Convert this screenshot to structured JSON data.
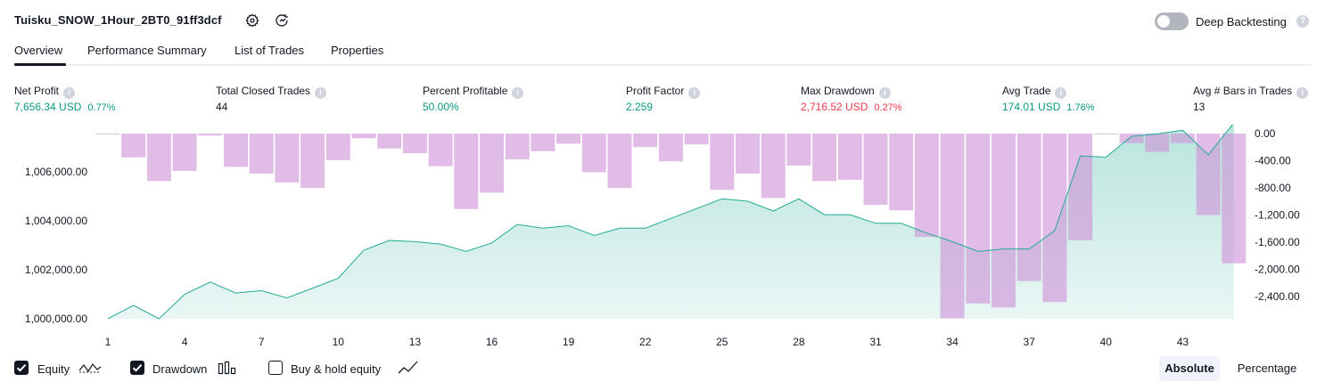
{
  "header": {
    "strategy_name": "Tuisku_SNOW_1Hour_2BT0_91ff3dcf",
    "icons": [
      "settings-icon",
      "compare-icon"
    ],
    "deep_backtesting_label": "Deep Backtesting",
    "deep_backtesting_enabled": false
  },
  "tabs": [
    {
      "label": "Overview",
      "active": true
    },
    {
      "label": "Performance Summary",
      "active": false
    },
    {
      "label": "List of Trades",
      "active": false
    },
    {
      "label": "Properties",
      "active": false
    }
  ],
  "metrics": [
    {
      "label": "Net Profit",
      "value": "7,656.34 USD",
      "pct": "0.77%",
      "color": "#089981"
    },
    {
      "label": "Total Closed Trades",
      "value": "44",
      "pct": "",
      "color": "#131722"
    },
    {
      "label": "Percent Profitable",
      "value": "50.00%",
      "pct": "",
      "color": "#089981"
    },
    {
      "label": "Profit Factor",
      "value": "2.259",
      "pct": "",
      "color": "#089981"
    },
    {
      "label": "Max Drawdown",
      "value": "2,716.52 USD",
      "pct": "0.27%",
      "color": "#f23645"
    },
    {
      "label": "Avg Trade",
      "value": "174.01 USD",
      "pct": "1.76%",
      "color": "#089981"
    },
    {
      "label": "Avg # Bars in Trades",
      "value": "13",
      "pct": "",
      "color": "#131722"
    }
  ],
  "chart_data": {
    "type": "area",
    "x_ticks": [
      "1",
      "4",
      "7",
      "10",
      "13",
      "16",
      "19",
      "22",
      "25",
      "28",
      "31",
      "34",
      "37",
      "40",
      "43"
    ],
    "y_left_ticks": [
      "1,000,000.00",
      "1,002,000.00",
      "1,004,000.00",
      "1,006,000.00"
    ],
    "y_right_ticks": [
      "0.00",
      "-400.00",
      "-800.00",
      "-1,200.00",
      "-1,600.00",
      "-2,000.00",
      "-2,400.00"
    ],
    "series": [
      {
        "name": "Equity",
        "x": [
          1,
          2,
          3,
          4,
          5,
          6,
          7,
          8,
          9,
          10,
          11,
          12,
          13,
          14,
          15,
          16,
          17,
          18,
          19,
          20,
          21,
          22,
          23,
          24,
          25,
          26,
          27,
          28,
          29,
          30,
          31,
          32,
          33,
          34,
          35,
          36,
          37,
          38,
          39,
          40,
          41,
          42,
          43,
          44,
          45
        ],
        "values": [
          1000000,
          1000550,
          1000000,
          1001000,
          1001500,
          1001050,
          1001150,
          1000850,
          1001250,
          1001650,
          1002800,
          1003200,
          1003150,
          1003050,
          1002750,
          1003100,
          1003850,
          1003700,
          1003800,
          1003400,
          1003700,
          1003700,
          1004100,
          1004500,
          1004900,
          1004800,
          1004400,
          1004900,
          1004250,
          1004250,
          1003900,
          1003900,
          1003500,
          1003150,
          1002750,
          1002850,
          1002850,
          1003600,
          1006650,
          1006600,
          1007450,
          1007550,
          1007700,
          1006700,
          1008000
        ],
        "color": "#22ab94"
      },
      {
        "name": "Drawdown",
        "x": [
          1,
          2,
          3,
          4,
          5,
          6,
          7,
          8,
          9,
          10,
          11,
          12,
          13,
          14,
          15,
          16,
          17,
          18,
          19,
          20,
          21,
          22,
          23,
          24,
          25,
          26,
          27,
          28,
          29,
          30,
          31,
          32,
          33,
          34,
          35,
          36,
          37,
          38,
          39,
          40,
          41,
          42,
          43,
          44,
          45
        ],
        "values": [
          -10,
          -350,
          -700,
          -550,
          -30,
          -490,
          -590,
          -720,
          -800,
          -390,
          -70,
          -220,
          -290,
          -480,
          -1110,
          -870,
          -380,
          -260,
          -150,
          -570,
          -800,
          -200,
          -410,
          -160,
          -830,
          -590,
          -950,
          -470,
          -700,
          -680,
          -1050,
          -1130,
          -1520,
          -2720,
          -2500,
          -2560,
          -2170,
          -2480,
          -1570,
          -10,
          -140,
          -270,
          -140,
          -1200,
          -1910
        ],
        "color": "#ce93d8"
      }
    ],
    "legend": [
      "Equity",
      "Drawdown",
      "Buy & hold equity"
    ]
  },
  "footer": {
    "equity_label": "Equity",
    "equity_checked": true,
    "drawdown_label": "Drawdown",
    "drawdown_checked": true,
    "buyhold_label": "Buy & hold equity",
    "buyhold_checked": false,
    "absolute_label": "Absolute",
    "percentage_label": "Percentage",
    "selected_mode": "Absolute"
  }
}
